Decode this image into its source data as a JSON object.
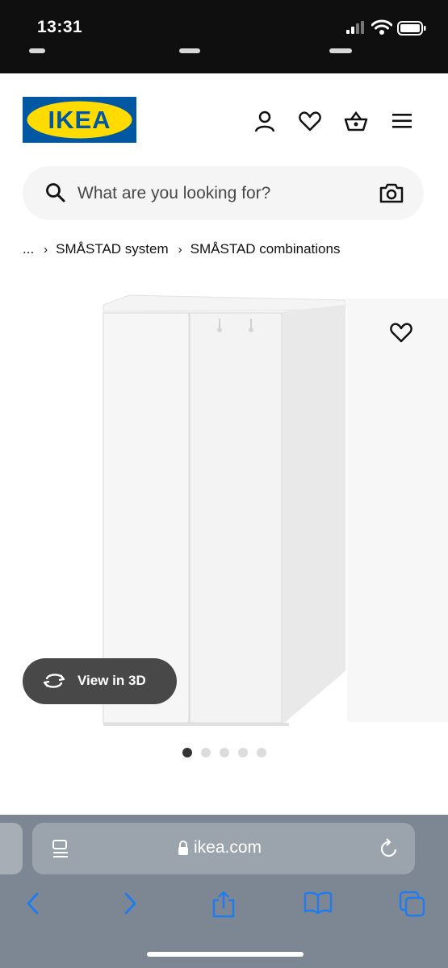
{
  "status_bar": {
    "time": "13:31"
  },
  "header": {
    "logo_text": "IKEA",
    "icons": [
      "profile-icon",
      "heart-icon",
      "basket-icon",
      "menu-icon"
    ]
  },
  "search": {
    "placeholder": "What are you looking for?"
  },
  "breadcrumb": {
    "ellipsis": "...",
    "items": [
      "SMÅSTAD system",
      "SMÅSTAD combinations"
    ]
  },
  "product": {
    "view3d_label": "View in 3D",
    "carousel": {
      "total": 5,
      "active": 1
    }
  },
  "browser": {
    "url": "ikea.com"
  },
  "colors": {
    "ikea_blue": "#0058a3",
    "ikea_yellow": "#ffdb00",
    "chip_dark": "#484848",
    "safari_blue": "#1e7cf0"
  }
}
